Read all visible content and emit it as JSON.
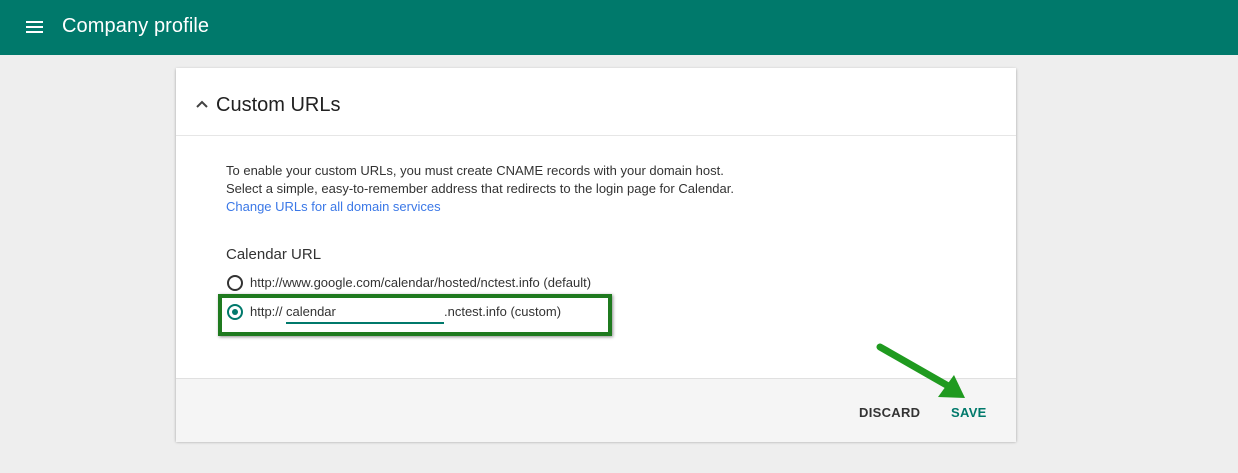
{
  "app_bar": {
    "title": "Company profile",
    "menu_icon": "hamburger-menu-icon",
    "background_color": "#00796b"
  },
  "card": {
    "header": {
      "title": "Custom URLs",
      "icon": "chevron-up-icon"
    },
    "description": {
      "line1": "To enable your custom URLs, you must create CNAME records with your domain host.",
      "line2": "Select a simple, easy-to-remember address that redirects to the login page for Calendar.",
      "link": "Change URLs for all domain services"
    },
    "calendar_url": {
      "label": "Calendar URL",
      "options": [
        {
          "text": "http://www.google.com/calendar/hosted/nctest.info (default)",
          "selected": false
        },
        {
          "prefix": "http://",
          "value": "calendar",
          "suffix": ".nctest.info  (custom)",
          "selected": true
        }
      ]
    },
    "footer": {
      "discard_label": "DISCARD",
      "save_label": "SAVE"
    }
  },
  "annotations": {
    "highlight_color": "#1f7a1f",
    "arrow_color": "#1f9a1f"
  }
}
